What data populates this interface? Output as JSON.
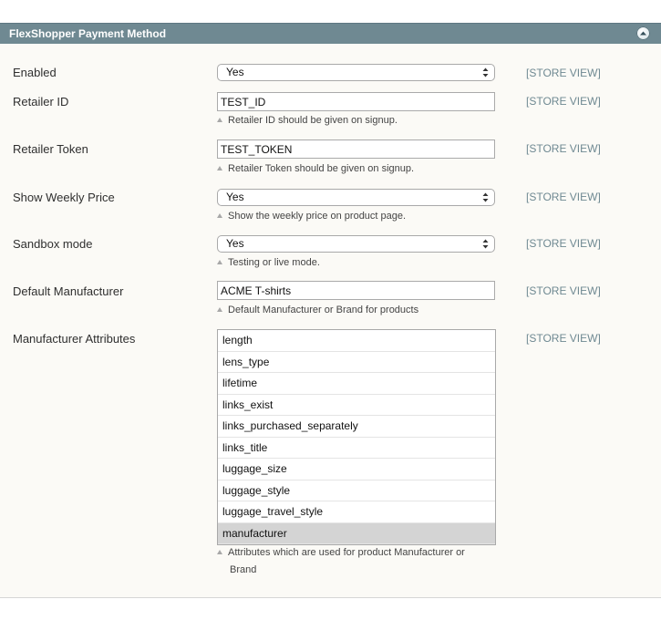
{
  "section": {
    "title": "FlexShopper Payment Method",
    "collapse_icon": "chevron-up-circle-icon"
  },
  "fields": {
    "enabled": {
      "label": "Enabled",
      "value": "Yes",
      "scope": "[STORE VIEW]"
    },
    "retailer_id": {
      "label": "Retailer ID",
      "value": "TEST_ID",
      "note": "Retailer ID should be given on signup.",
      "scope": "[STORE VIEW]"
    },
    "retailer_token": {
      "label": "Retailer Token",
      "value": "TEST_TOKEN",
      "note": "Retailer Token should be given on signup.",
      "scope": "[STORE VIEW]"
    },
    "show_weekly_price": {
      "label": "Show Weekly Price",
      "value": "Yes",
      "note": "Show the weekly price on product page.",
      "scope": "[STORE VIEW]"
    },
    "sandbox_mode": {
      "label": "Sandbox mode",
      "value": "Yes",
      "note": "Testing or live mode.",
      "scope": "[STORE VIEW]"
    },
    "default_manufacturer": {
      "label": "Default Manufacturer",
      "value": "ACME T-shirts",
      "note": "Default Manufacturer or Brand for products",
      "scope": "[STORE VIEW]"
    },
    "manufacturer_attributes": {
      "label": "Manufacturer Attributes",
      "scope": "[STORE VIEW]",
      "options": [
        "length",
        "lens_type",
        "lifetime",
        "links_exist",
        "links_purchased_separately",
        "links_title",
        "luggage_size",
        "luggage_style",
        "luggage_travel_style",
        "manufacturer"
      ],
      "selected": "manufacturer",
      "note_line1": "Attributes which are used for product Manufacturer or",
      "note_line2": "Brand"
    }
  },
  "colors": {
    "header_bg": "#6f8992",
    "panel_bg": "#fbfaf6",
    "scope_text": "#6f8992",
    "selected_option_bg": "#d4d4d4"
  }
}
